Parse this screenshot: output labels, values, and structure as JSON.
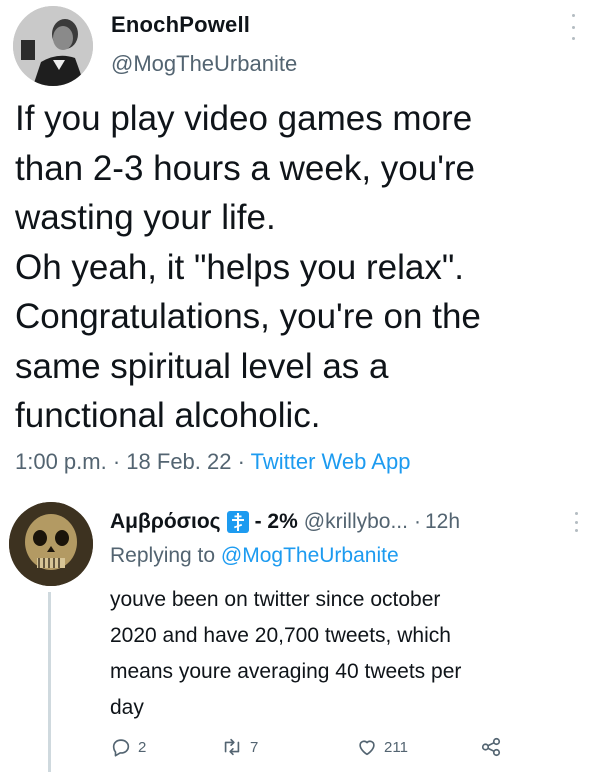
{
  "main_tweet": {
    "display_name": "EnochPowell",
    "handle": "@MogTheUrbanite",
    "text_lines": [
      "If you play video games more",
      "than 2-3 hours a week, you're",
      "wasting your life.",
      "Oh yeah, it \"helps you relax\".",
      "Congratulations, you're on the",
      "same spiritual level as a",
      "functional alcoholic."
    ],
    "time": "1:00 p.m.",
    "separator": "·",
    "date": "18 Feb. 22",
    "source": "Twitter Web App"
  },
  "reply": {
    "display_name": "Αμβρόσιος",
    "badge_icon": "orthodox-cross-icon",
    "name_suffix": "- 2%",
    "handle": "@krillybo...",
    "time_separator": "·",
    "time": "12h",
    "replying_prefix": "Replying to",
    "replying_to": "@MogTheUrbanite",
    "text_lines": [
      "youve been on twitter since october",
      "2020 and have 20,700 tweets, which",
      "means youre averaging 40 tweets per",
      "day"
    ],
    "actions": {
      "reply_count": "2",
      "retweet_count": "7",
      "like_count": "211"
    }
  },
  "colors": {
    "text": "#0f1419",
    "secondary": "#536471",
    "link": "#1d9bf0",
    "thread_line": "#cfd9de"
  }
}
